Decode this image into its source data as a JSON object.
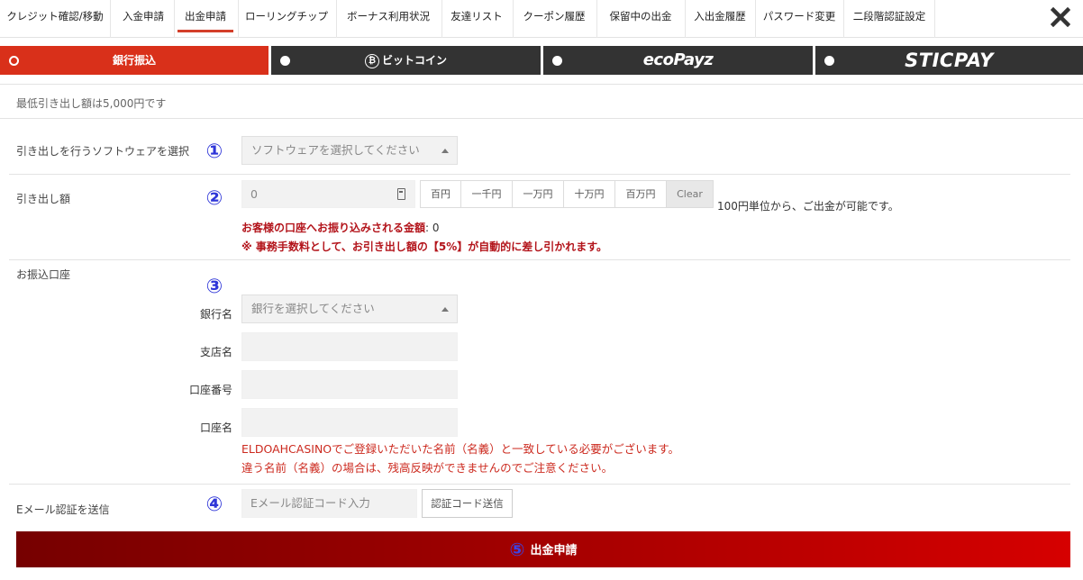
{
  "nav": {
    "tabs": [
      {
        "label": "クレジット確認/移動"
      },
      {
        "label": "入金申請"
      },
      {
        "label": "出金申請",
        "active": true
      },
      {
        "label": "ローリングチップ"
      },
      {
        "label": "ボーナス利用状況"
      },
      {
        "label": "友達リスト"
      },
      {
        "label": "クーポン履歴"
      },
      {
        "label": "保留中の出金"
      },
      {
        "label": "入出金履歴"
      },
      {
        "label": "パスワード変更"
      },
      {
        "label": "二段階認証設定"
      }
    ],
    "close_icon": "close-x-icon"
  },
  "methods": [
    {
      "label": "銀行振込",
      "selected": true
    },
    {
      "label": "ビットコイン",
      "icon": "bitcoin-icon",
      "selected": false
    },
    {
      "label": "ecoPayz",
      "selected": false
    },
    {
      "label": "STICPAY",
      "selected": false
    }
  ],
  "min_note": "最低引き出し額は5,000円です",
  "software": {
    "label": "引き出しを行うソフトウェアを選択",
    "step": "①",
    "placeholder": "ソフトウェアを選択してください"
  },
  "amount": {
    "label": "引き出し額",
    "step": "②",
    "value": "0",
    "buttons": [
      "百円",
      "一千円",
      "一万円",
      "十万円",
      "百万円",
      "Clear"
    ],
    "unit_note": "100円単位から、ご出金が可能です。",
    "receive_label": "お客様の口座へお振り込みされる金額",
    "receive_value": ": 0",
    "fee_note": "※ 事務手数料として、お引き出し額の【5%】が自動的に差し引かれます。"
  },
  "bank": {
    "label": "お振込口座",
    "step": "③",
    "bank_name_label": "銀行名",
    "bank_placeholder": "銀行を選択してください",
    "branch_label": "支店名",
    "account_number_label": "口座番号",
    "account_name_label": "口座名",
    "note1": "ELDOAHCASINOでご登録いただいた名前（名義）と一致している必要がございます。",
    "note2": "違う名前（名義）の場合は、残高反映ができませんのでご注意ください。"
  },
  "email": {
    "label": "Eメール認証を送信",
    "step": "④",
    "placeholder": "Eメール認証コード入力",
    "send_label": "認証コード送信"
  },
  "submit": {
    "step": "⑤",
    "label": "出金申請"
  },
  "colors": {
    "accent_red": "#d9301a",
    "dark_bar": "#333333",
    "step_blue": "#2f36d8"
  }
}
